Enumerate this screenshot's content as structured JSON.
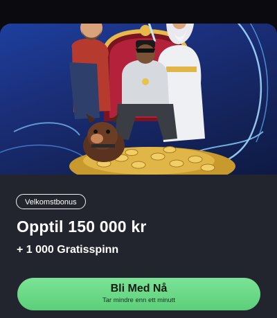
{
  "promo": {
    "badge": "Velkomstbonus",
    "amount": "Opptil 150 000 kr",
    "spins": "+ 1 000 Gratisspinn",
    "cta_label": "Bli Med Nå",
    "cta_sublabel": "Tar mindre enn ett minutt"
  },
  "colors": {
    "card_background": "#23252e",
    "hero_background": "#1b2f7a",
    "cta_green": "#6bdb86"
  },
  "hero": {
    "illustration": "cowboy, rapper on throne, zeus and dog on gold coins"
  }
}
